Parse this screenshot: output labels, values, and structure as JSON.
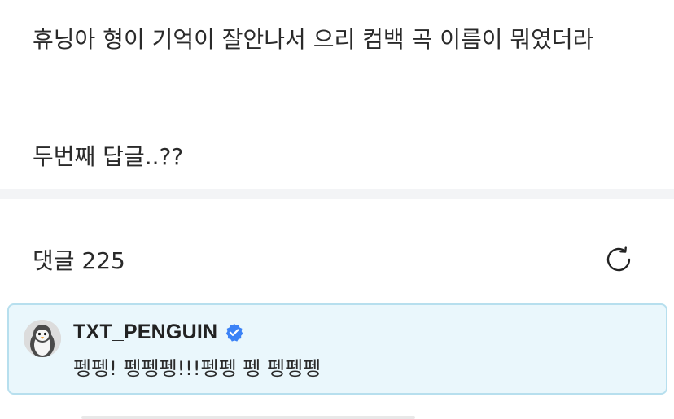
{
  "post": {
    "line1": "휴닝아 형이 기억이 잘안나서 으리 컴백 곡 이름이 뭐였더라",
    "line2": "두번째 답글..??"
  },
  "comments": {
    "header_label": "댓글 225",
    "refresh_icon": "refresh-icon"
  },
  "comment": {
    "author": "TXT_PENGUIN",
    "verified_icon": "verified-badge-icon",
    "text": "펭펭! 펭펭펭!!!펭펭 펭 펭펭펭",
    "avatar_icon": "penguin-avatar",
    "highlight_color": "#eaf7fc",
    "border_color": "#b7dfee",
    "badge_color": "#3b82f6"
  }
}
